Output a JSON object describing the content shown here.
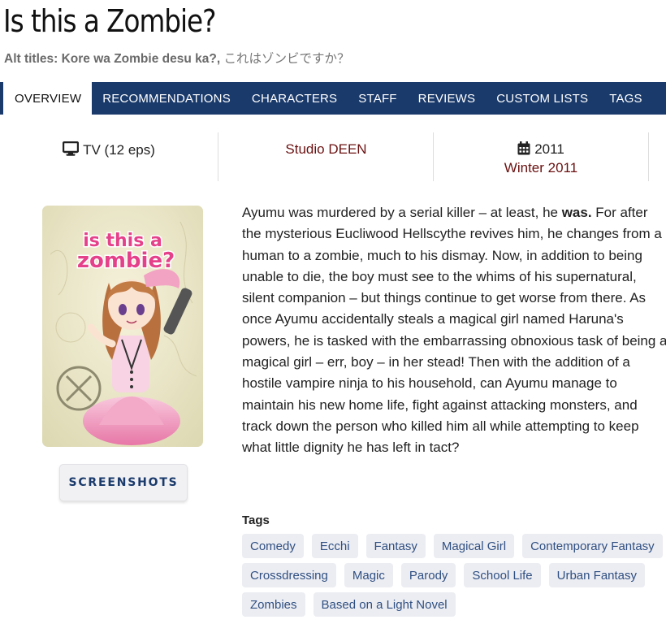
{
  "header": {
    "title": "Is this a Zombie?",
    "alt_label": "Alt titles: Kore wa Zombie desu ka?,",
    "alt_rest": "これはゾンビですか？"
  },
  "tabs": [
    "OVERVIEW",
    "RECOMMENDATIONS",
    "CHARACTERS",
    "STAFF",
    "REVIEWS",
    "CUSTOM LISTS",
    "TAGS"
  ],
  "info": {
    "type": "TV (12 eps)",
    "studio": "Studio DEEN",
    "year": "2011",
    "season": "Winter 2011"
  },
  "poster": {
    "logo_line1": "is this a",
    "logo_line2": "zombie?"
  },
  "screenshots_label": "SCREENSHOTS",
  "synopsis": {
    "part1": "Ayumu was murdered by a serial killer – at least, he ",
    "bold": "was.",
    "part2": " For after the mysterious Eucliwood Hellscythe revives him, he changes from a human to a zombie, much to his dismay. Now, in addition to being unable to die, the boy must see to the whims of his supernatural, silent companion – but things continue to get worse from there. As once Ayumu accidentally steals a magical girl named Haruna's powers, he is tasked with the embarrassing obnoxious task of being a magical girl – err, boy – in her stead! Then with the addition of a hostile vampire ninja to his household, can Ayumu manage to maintain his new home life, fight against attacking monsters, and track down the person who killed him all while attempting to keep what little dignity he has left in tact?"
  },
  "tags_heading": "Tags",
  "tags": [
    [
      "Comedy",
      "Ecchi",
      "Fantasy",
      "Magical Girl",
      "Contemporary Fantasy"
    ],
    [
      "Crossdressing",
      "Magic",
      "Parody",
      "School Life",
      "Urban Fantasy"
    ],
    [
      "Zombies",
      "Based on a Light Novel"
    ]
  ],
  "colors": {
    "nav_bg": "#1a3a6b",
    "link_red": "#6b1010",
    "tag_bg": "#ecedf2",
    "tag_text": "#2f4f82"
  },
  "icons": {
    "type_icon": "monitor-icon",
    "date_icon": "calendar-icon"
  }
}
